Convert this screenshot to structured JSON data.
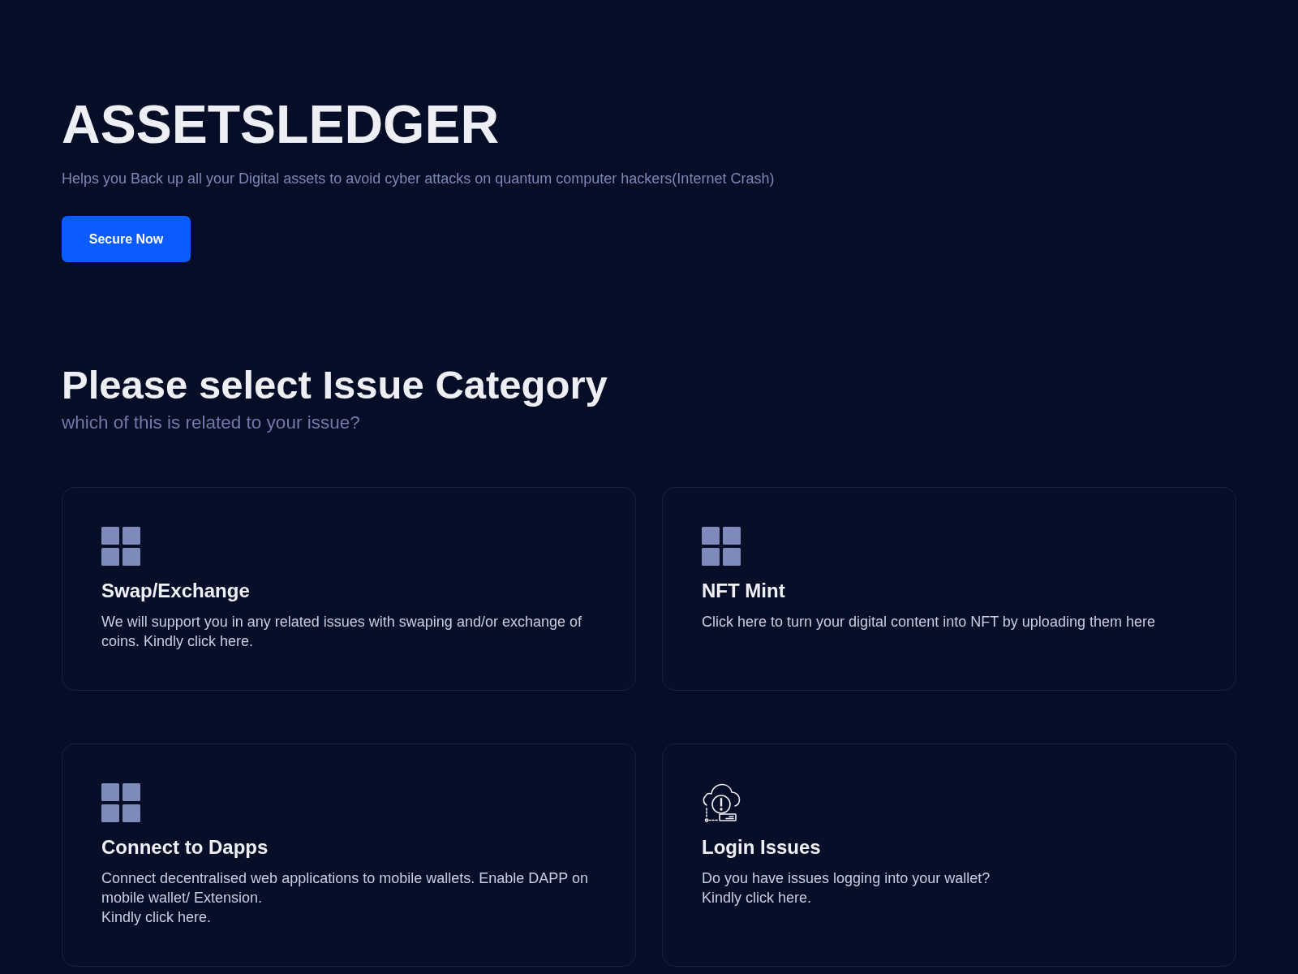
{
  "hero": {
    "title": "ASSETSLEDGER",
    "tagline": "Helps you Back up all your Digital assets to avoid cyber attacks on quantum computer hackers(Internet Crash)",
    "button": "Secure Now"
  },
  "section": {
    "title": "Please select Issue Category",
    "subtitle": "which of this is related to your issue?"
  },
  "categories": [
    {
      "kind": "grid",
      "title": "Swap/Exchange",
      "lines": [
        "We will support you in any related issues with swaping and/or exchange of coins. Kindly click here."
      ]
    },
    {
      "kind": "grid",
      "title": "NFT Mint",
      "lines": [
        "Click here to turn your digital content into NFT by uploading them here"
      ]
    },
    {
      "kind": "grid",
      "title": "Connect to Dapps",
      "lines": [
        "Connect decentralised web applications to mobile wallets. Enable DAPP on mobile wallet/ Extension.",
        "Kindly click here."
      ]
    },
    {
      "kind": "cloud-alert",
      "title": "Login Issues",
      "lines": [
        "Do you have issues logging into your wallet?",
        "Kindly click here."
      ]
    }
  ]
}
